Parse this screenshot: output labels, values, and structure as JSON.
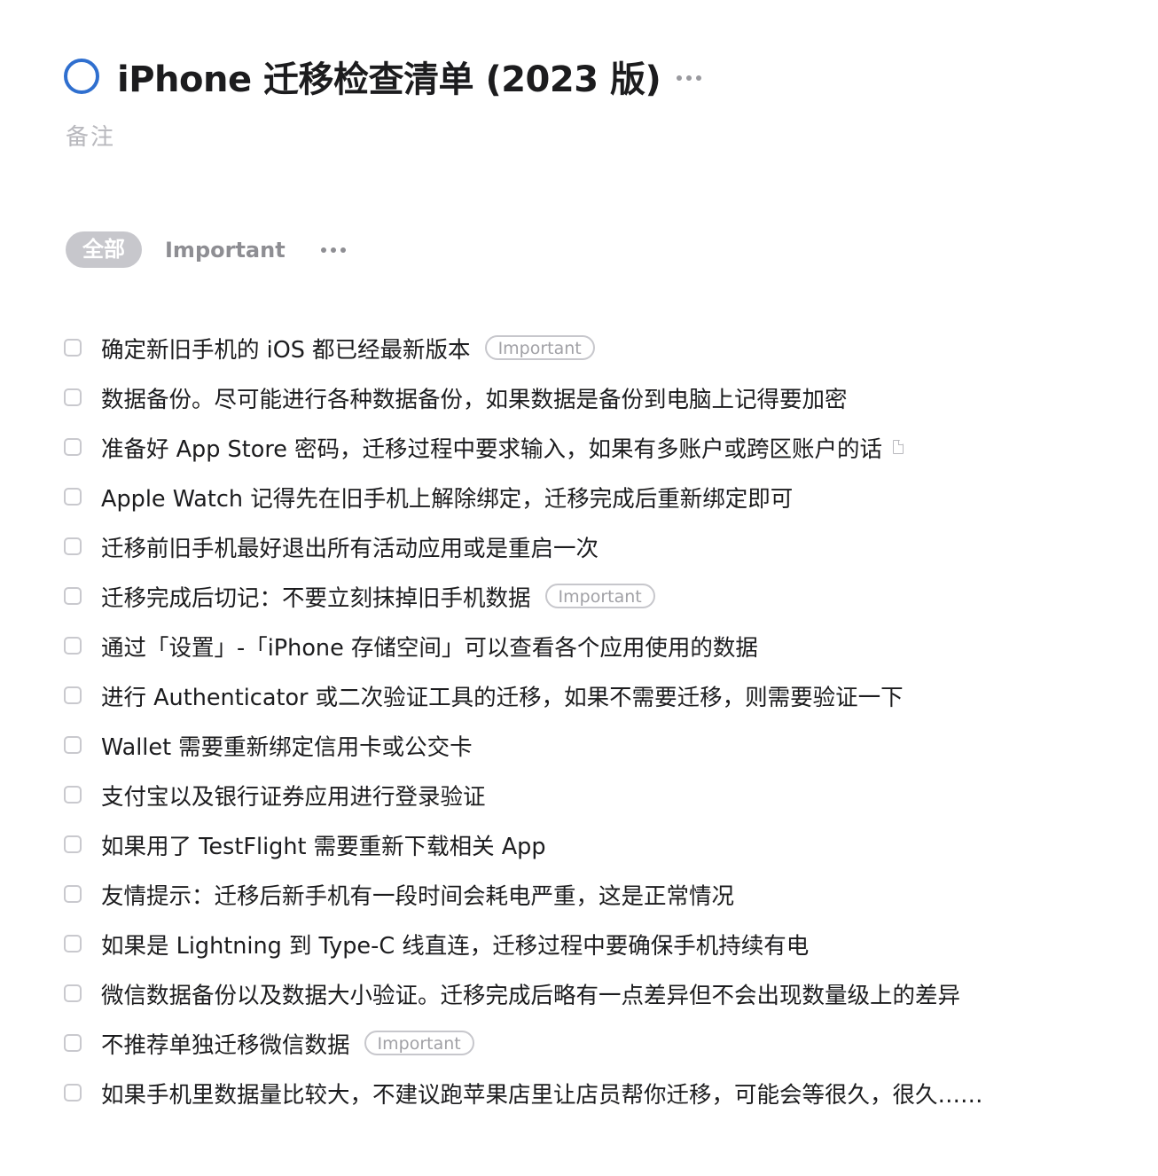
{
  "project": {
    "title": "iPhone 迁移检查清单 (2023 版)",
    "notes_placeholder": "备注",
    "accent_color": "#2f6fcf"
  },
  "tabs": [
    {
      "label": "全部",
      "active": true
    },
    {
      "label": "Important",
      "active": false
    }
  ],
  "todos": [
    {
      "text": "确定新旧手机的 iOS 都已经最新版本",
      "tag": "Important",
      "has_note": false
    },
    {
      "text": "数据备份。尽可能进行各种数据备份，如果数据是备份到电脑上记得要加密",
      "tag": "",
      "has_note": false
    },
    {
      "text": "准备好 App Store 密码，迁移过程中要求输入，如果有多账户或跨区账户的话",
      "tag": "",
      "has_note": true
    },
    {
      "text": "Apple Watch 记得先在旧手机上解除绑定，迁移完成后重新绑定即可",
      "tag": "",
      "has_note": false
    },
    {
      "text": "迁移前旧手机最好退出所有活动应用或是重启一次",
      "tag": "",
      "has_note": false
    },
    {
      "text": "迁移完成后切记：不要立刻抹掉旧手机数据",
      "tag": "Important",
      "has_note": false
    },
    {
      "text": "通过「设置」-「iPhone 存储空间」可以查看各个应用使用的数据",
      "tag": "",
      "has_note": false
    },
    {
      "text": "进行 Authenticator 或二次验证工具的迁移，如果不需要迁移，则需要验证一下",
      "tag": "",
      "has_note": false
    },
    {
      "text": "Wallet 需要重新绑定信用卡或公交卡",
      "tag": "",
      "has_note": false
    },
    {
      "text": "支付宝以及银行证券应用进行登录验证",
      "tag": "",
      "has_note": false
    },
    {
      "text": "如果用了 TestFlight 需要重新下载相关 App",
      "tag": "",
      "has_note": false
    },
    {
      "text": "友情提示：迁移后新手机有一段时间会耗电严重，这是正常情况",
      "tag": "",
      "has_note": false
    },
    {
      "text": "如果是 Lightning 到 Type-C 线直连，迁移过程中要确保手机持续有电",
      "tag": "",
      "has_note": false
    },
    {
      "text": "微信数据备份以及数据大小验证。迁移完成后略有一点差异但不会出现数量级上的差异",
      "tag": "",
      "has_note": false
    },
    {
      "text": "不推荐单独迁移微信数据",
      "tag": "Important",
      "has_note": false
    },
    {
      "text": "如果手机里数据量比较大，不建议跑苹果店里让店员帮你迁移，可能会等很久，很久……",
      "tag": "",
      "has_note": false
    }
  ]
}
